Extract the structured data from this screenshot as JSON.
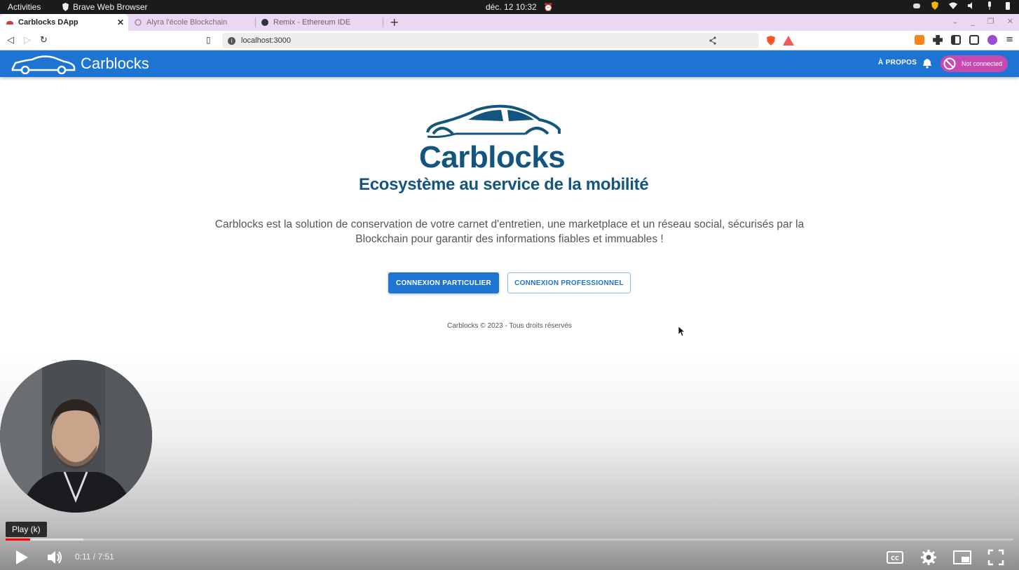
{
  "system_bar": {
    "activities": "Activities",
    "app_name": "Brave Web Browser",
    "datetime": "déc. 12  10:32"
  },
  "browser": {
    "tabs": [
      {
        "label": "Carblocks DApp",
        "active": true
      },
      {
        "label": "Alyra l'école Blockchain",
        "active": false
      },
      {
        "label": "Remix - Ethereum IDE",
        "active": false
      }
    ],
    "url": "localhost:3000"
  },
  "app": {
    "brand": "Carblocks",
    "nav_about": "À PROPOS",
    "wallet_status": "Not connected"
  },
  "hero": {
    "title": "Carblocks",
    "subtitle": "Ecosystème au service de la mobilité",
    "description": "Carblocks est la solution de conservation de votre carnet d'entretien, une marketplace et un réseau social, sécurisés par la Blockchain pour garantir des informations fiables et immuables !",
    "btn_individual": "CONNEXION PARTICULIER",
    "btn_professional": "CONNEXION PROFESSIONNEL"
  },
  "footer": {
    "text": "Carblocks © 2023 - Tous droits réservés"
  },
  "video_player": {
    "tooltip": "Play (k)",
    "time": "0:11 / 7:51",
    "played_fraction": 0.024,
    "buffered_fraction": 0.077
  },
  "colors": {
    "primary": "#1e74d2",
    "logo_blue": "#13557e",
    "wallet_chip": "#c74ab1"
  }
}
